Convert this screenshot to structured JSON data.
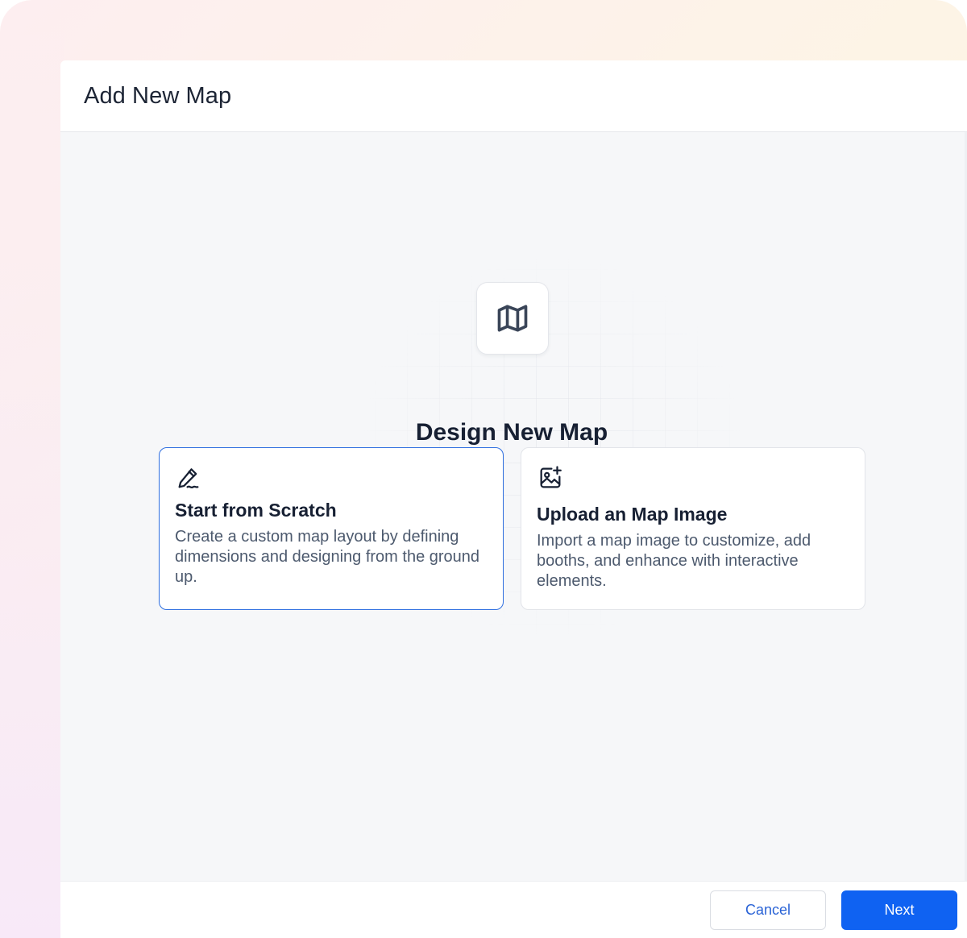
{
  "dialog": {
    "title": "Add New Map"
  },
  "hero": {
    "icon": "map-icon",
    "title": "Design New Map"
  },
  "options": [
    {
      "icon": "pen-signature-icon",
      "title": "Start from Scratch",
      "description": "Create a custom map layout by defining dimensions and designing from the ground up.",
      "selected": true
    },
    {
      "icon": "image-plus-icon",
      "title": "Upload an Map Image",
      "description": "Import a map image to customize, add booths, and enhance with interactive elements.",
      "selected": false
    }
  ],
  "footer": {
    "cancel_label": "Cancel",
    "next_label": "Next"
  },
  "colors": {
    "accent": "#0f62f2",
    "selected_border": "#2f6fe0",
    "text_dark": "#172033",
    "text_muted": "#4d5a6e"
  }
}
